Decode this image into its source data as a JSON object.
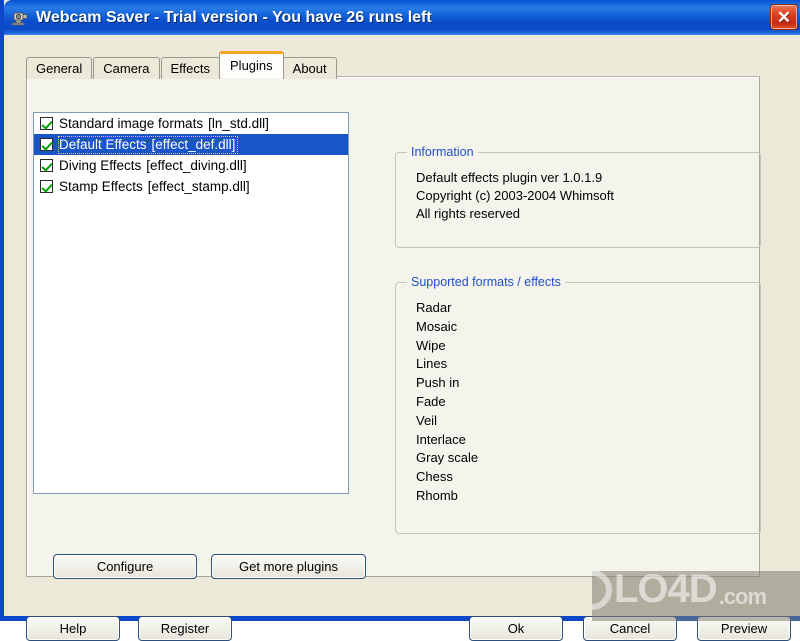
{
  "window": {
    "title": "Webcam Saver  - Trial version - You have 26 runs left",
    "icon": "webcam-icon",
    "close_label": "✕",
    "accent_titlebar": "#0B49C8",
    "accent_tab": "#F5A623",
    "accent_selection": "#1a55c8"
  },
  "tabs": [
    {
      "label": "General",
      "active": false
    },
    {
      "label": "Camera",
      "active": false
    },
    {
      "label": "Effects",
      "active": false
    },
    {
      "label": "Plugins",
      "active": true
    },
    {
      "label": "About",
      "active": false
    }
  ],
  "plugins": [
    {
      "checked": true,
      "name": "Standard image formats",
      "file": "[ln_std.dll]",
      "selected": false
    },
    {
      "checked": true,
      "name": "Default Effects",
      "file": "[effect_def.dll]",
      "selected": true
    },
    {
      "checked": true,
      "name": "Diving Effects",
      "file": "[effect_diving.dll]",
      "selected": false
    },
    {
      "checked": true,
      "name": "Stamp Effects",
      "file": "[effect_stamp.dll]",
      "selected": false
    }
  ],
  "information": {
    "title": "Information",
    "lines": [
      "Default effects plugin ver 1.0.1.9",
      "Copyright (c) 2003-2004 Whimsoft",
      "All rights reserved"
    ]
  },
  "supported": {
    "title": "Supported formats / effects",
    "items": [
      "Radar",
      "Mosaic",
      "Wipe",
      "Lines",
      "Push in",
      "Fade",
      "Veil",
      "Interlace",
      "Gray scale",
      "Chess",
      "Rhomb"
    ]
  },
  "buttons": {
    "configure": "Configure",
    "get_more_plugins": "Get more plugins",
    "help": "Help",
    "register": "Register",
    "ok": "Ok",
    "cancel": "Cancel",
    "preview": "Preview"
  },
  "watermark": {
    "prefix": "LO4D",
    "suffix": ".com"
  }
}
